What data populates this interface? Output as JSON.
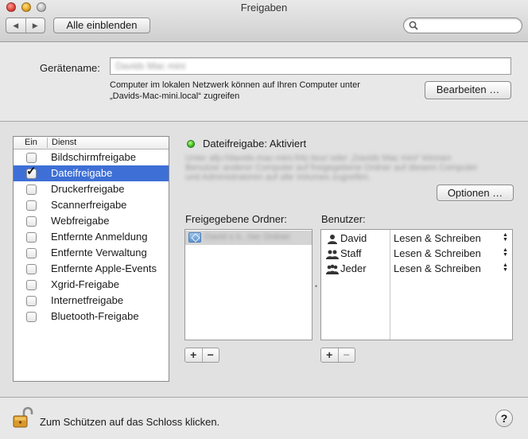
{
  "window": {
    "title": "Freigaben",
    "nav_back": "◀",
    "nav_forward": "▶",
    "show_all_label": "Alle einblenden",
    "search_placeholder": ""
  },
  "device": {
    "name_label": "Gerätename:",
    "name_value": "Davids Mac mini",
    "info_line1": "Computer im lokalen Netzwerk können auf Ihren Computer unter",
    "info_line2": "„Davids-Mac-mini.local“ zugreifen",
    "edit_button": "Bearbeiten …"
  },
  "services": {
    "col_on": "Ein",
    "col_service": "Dienst",
    "items": [
      {
        "label": "Bildschirmfreigabe",
        "checked": false,
        "selected": false
      },
      {
        "label": "Dateifreigabe",
        "checked": true,
        "selected": true
      },
      {
        "label": "Druckerfreigabe",
        "checked": false,
        "selected": false
      },
      {
        "label": "Scannerfreigabe",
        "checked": false,
        "selected": false
      },
      {
        "label": "Webfreigabe",
        "checked": false,
        "selected": false
      },
      {
        "label": "Entfernte Anmeldung",
        "checked": false,
        "selected": false
      },
      {
        "label": "Entfernte Verwaltung",
        "checked": false,
        "selected": false
      },
      {
        "label": "Entfernte Apple-Events",
        "checked": false,
        "selected": false
      },
      {
        "label": "Xgrid-Freigabe",
        "checked": false,
        "selected": false
      },
      {
        "label": "Internetfreigabe",
        "checked": false,
        "selected": false
      },
      {
        "label": "Bluetooth-Freigabe",
        "checked": false,
        "selected": false
      }
    ]
  },
  "file_sharing": {
    "status": "Dateifreigabe: Aktiviert",
    "status_color": "#37b81a",
    "description_line1": "Unter afp://davids-mac-mini.fritz.box/ oder „Davids Mac mini“ können",
    "description_line2": "Benutzer anderer Computer auf freigegebene Ordner auf diesem Computer",
    "description_line3": "und Administratoren auf alle Volumes zugreifen.",
    "options_button": "Optionen …",
    "shared_folders_label": "Freigegebene Ordner:",
    "users_label": "Benutzer:",
    "folders": [
      {
        "name": "David s ö...her Ordner"
      }
    ],
    "users": [
      {
        "name": "David",
        "permission": "Lesen & Schreiben",
        "icon": "single-user-icon"
      },
      {
        "name": "Staff",
        "permission": "Lesen & Schreiben",
        "icon": "group-icon"
      },
      {
        "name": "Jeder",
        "permission": "Lesen & Schreiben",
        "icon": "everyone-icon"
      }
    ],
    "add_label": "+",
    "remove_label": "−"
  },
  "footer": {
    "lock_text": "Zum Schützen auf das Schloss klicken.",
    "help_label": "?"
  },
  "colors": {
    "selection": "#3d6fd6"
  }
}
